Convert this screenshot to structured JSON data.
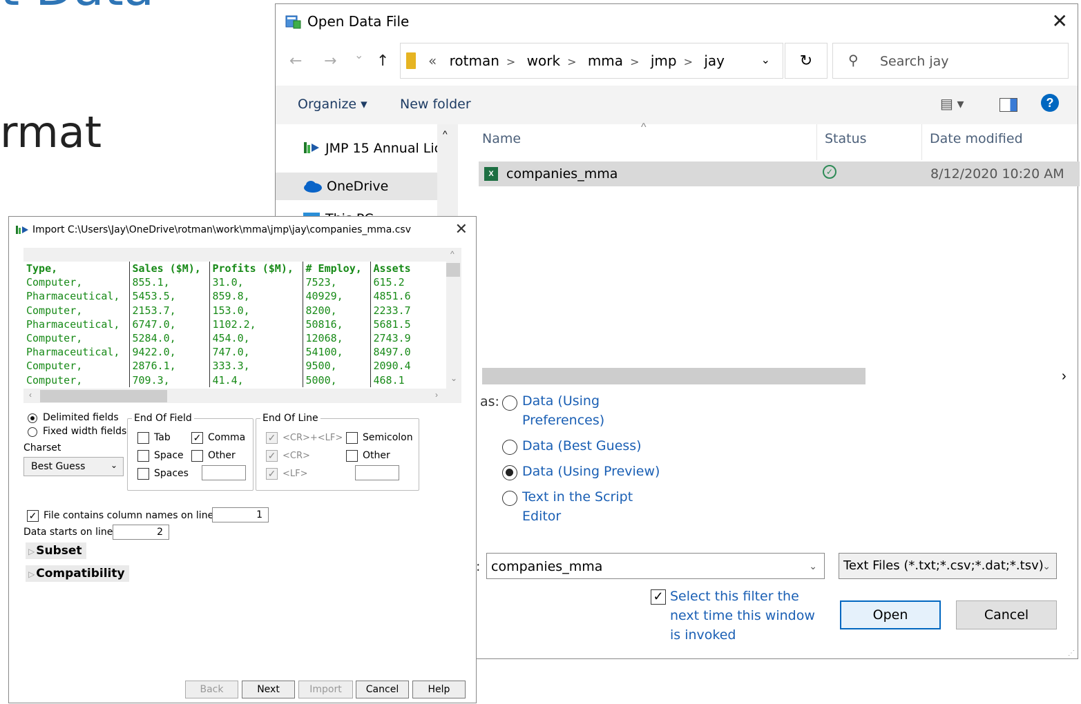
{
  "background": {
    "title_fragment": "t Data",
    "subtitle_fragment": "rmat"
  },
  "open_dialog": {
    "title": "Open Data File",
    "close": "✕",
    "nav": {
      "back": "←",
      "forward": "→",
      "recent": "⌄",
      "up": "↑"
    },
    "breadcrumb": {
      "prefix": "«",
      "items": [
        "rotman",
        "work",
        "mma",
        "jmp",
        "jay"
      ]
    },
    "refresh": "↻",
    "search": {
      "placeholder": "Search jay"
    },
    "toolbar": {
      "organize": "Organize ▾",
      "new_folder": "New folder",
      "view_icon": "▤ ▾",
      "help": "?"
    },
    "left_nav": [
      {
        "label": "JMP 15 Annual Lic",
        "icon": "jmp-icon"
      },
      {
        "label": "OneDrive",
        "icon": "cloud-icon"
      },
      {
        "label": "This PC",
        "icon": "pc-icon"
      }
    ],
    "columns": {
      "name": "Name",
      "status": "Status",
      "date": "Date modified"
    },
    "files": [
      {
        "name": "companies_mma",
        "status": "✓",
        "date": "8/12/2020 10:20 AM"
      }
    ],
    "open_as_label": "as:",
    "open_as": [
      {
        "label": "Data (Using",
        "label2": "Preferences)",
        "selected": false
      },
      {
        "label": "Data (Best Guess)",
        "selected": false
      },
      {
        "label": "Data (Using Preview)",
        "selected": true
      },
      {
        "label": "Text in the Script",
        "label2": "Editor",
        "selected": false
      }
    ],
    "filename_label": ":",
    "filename": "companies_mma",
    "file_type": "Text Files (*.txt;*.csv;*.dat;*.tsv)",
    "select_filter": {
      "checked": true,
      "label": "Select this filter the next time this window is invoked"
    },
    "open_button": "Open",
    "cancel_button": "Cancel"
  },
  "import_dialog": {
    "title": "Import C:\\Users\\Jay\\OneDrive\\rotman\\work\\mma\\jmp\\jay\\companies_mma.csv",
    "close": "✕",
    "preview": {
      "headers": [
        "Type,",
        "Sales ($M),",
        "Profits ($M),",
        "# Employ,",
        "Assets"
      ],
      "rows": [
        [
          "Computer,",
          "855.1,",
          "31.0,",
          "7523,",
          "615.2"
        ],
        [
          "Pharmaceutical,",
          "5453.5,",
          "859.8,",
          "40929,",
          "4851.6"
        ],
        [
          "Computer,",
          "2153.7,",
          "153.0,",
          "8200,",
          "2233.7"
        ],
        [
          "Pharmaceutical,",
          "6747.0,",
          "1102.2,",
          "50816,",
          "5681.5"
        ],
        [
          "Computer,",
          "5284.0,",
          "454.0,",
          "12068,",
          "2743.9"
        ],
        [
          "Pharmaceutical,",
          "9422.0,",
          "747.0,",
          "54100,",
          "8497.0"
        ],
        [
          "Computer,",
          "2876.1,",
          "333.3,",
          "9500,",
          "2090.4"
        ],
        [
          "Computer,",
          "709.3,",
          "41.4,",
          "5000,",
          "468.1"
        ]
      ]
    },
    "field_mode": {
      "delimited": "Delimited fields",
      "fixed": "Fixed width fields",
      "selected": "delimited"
    },
    "charset_label": "Charset",
    "charset_value": "Best Guess",
    "end_of_field": {
      "legend": "End Of Field",
      "tab": {
        "label": "Tab",
        "checked": false
      },
      "comma": {
        "label": "Comma",
        "checked": true
      },
      "space": {
        "label": "Space",
        "checked": false
      },
      "other": {
        "label": "Other",
        "checked": false
      },
      "spaces": {
        "label": "Spaces",
        "checked": false
      }
    },
    "end_of_line": {
      "legend": "End Of Line",
      "crlf": {
        "label": "<CR>+<LF>",
        "checked": true
      },
      "cr": {
        "label": "<CR>",
        "checked": true
      },
      "lf": {
        "label": "<LF>",
        "checked": true
      },
      "semicolon": {
        "label": "Semicolon",
        "checked": false
      },
      "other": {
        "label": "Other",
        "checked": false
      }
    },
    "col_names": {
      "label": "File contains column names on line:",
      "checked": true,
      "value": "1"
    },
    "data_starts": {
      "label": "Data starts on line:",
      "value": "2"
    },
    "subset": "Subset",
    "compatibility": "Compatibility",
    "buttons": {
      "back": "Back",
      "next": "Next",
      "import": "Import",
      "cancel": "Cancel",
      "help": "Help"
    }
  }
}
